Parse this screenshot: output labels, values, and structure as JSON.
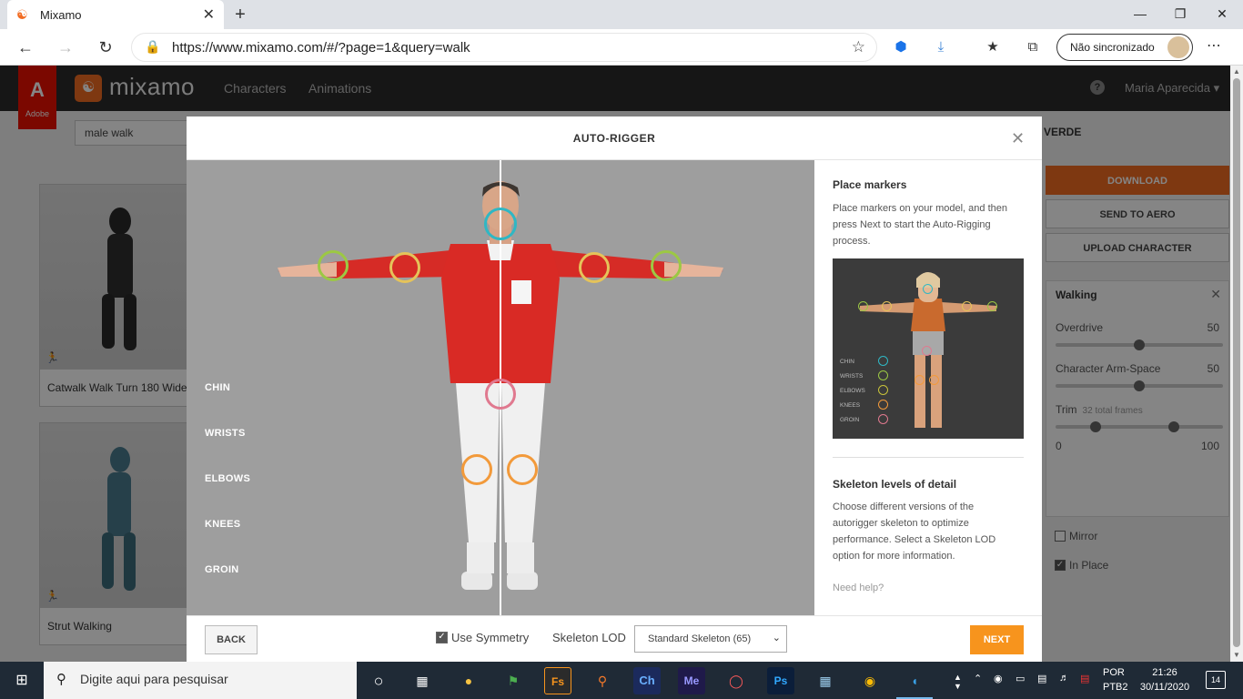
{
  "browser": {
    "tab_title": "Mixamo",
    "url": "https://www.mixamo.com/#/?page=1&query=walk",
    "sync_label": "Não sincronizado"
  },
  "site": {
    "brand": "mixamo",
    "adobe_label": "Adobe",
    "nav": [
      "Characters",
      "Animations"
    ],
    "user": "Maria Aparecida",
    "search_value": "male walk",
    "cards": [
      {
        "label": "Catwalk Walk Turn 180 Wide"
      },
      {
        "label": "Strut Walking"
      }
    ],
    "right": {
      "title": "VERDE",
      "download": "DOWNLOAD",
      "send_aero": "SEND TO AERO",
      "upload": "UPLOAD CHARACTER",
      "panel_title": "Walking",
      "overdrive_label": "Overdrive",
      "overdrive_value": "50",
      "arm_label": "Character Arm-Space",
      "arm_value": "50",
      "trim_label": "Trim",
      "trim_frames": "32 total frames",
      "trim_min": "0",
      "trim_max": "100",
      "mirror": "Mirror",
      "in_place": "In Place"
    }
  },
  "modal": {
    "title": "AUTO-RIGGER",
    "markers": [
      "CHIN",
      "WRISTS",
      "ELBOWS",
      "KNEES",
      "GROIN"
    ],
    "marker_colors": {
      "chin": "#2fb7c4",
      "wrists": "#9cc844",
      "elbows": "#e5c35a",
      "knees": "#f29a3b",
      "groin": "#e0798f"
    },
    "place_title": "Place markers",
    "place_text": "Place markers on your model, and then press Next to start the Auto-Rigging process.",
    "lod_title": "Skeleton levels of detail",
    "lod_text": "Choose different versions of the autorigger skeleton to optimize performance. Select a Skeleton LOD option for more information.",
    "need_help": "Need help?",
    "back": "BACK",
    "use_symmetry": "Use Symmetry",
    "skeleton_lod_label": "Skeleton LOD",
    "skeleton_lod_value": "Standard Skeleton (65)",
    "next": "NEXT"
  },
  "taskbar": {
    "search_placeholder": "Digite aqui para pesquisar",
    "lang1": "POR",
    "lang2": "PTB2",
    "time": "21:26",
    "date": "30/11/2020",
    "notifications": "14"
  }
}
